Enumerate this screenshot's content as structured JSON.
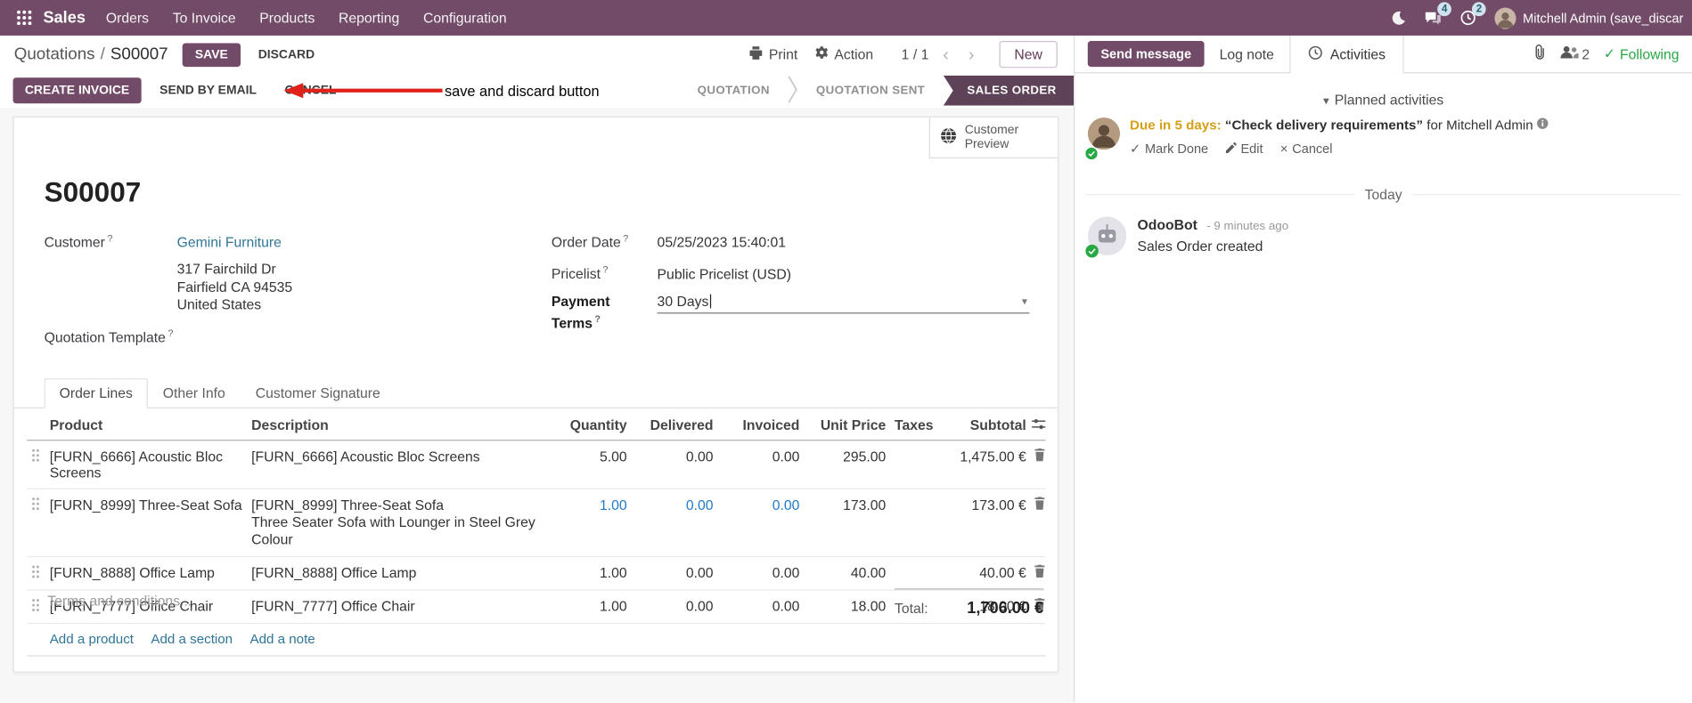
{
  "icons": {
    "prev": "‹",
    "next": "›",
    "caret_down": "▾",
    "check": "✓",
    "close": "×",
    "help": "?"
  },
  "colors": {
    "primary": "#714B67",
    "stage_active": "#5E4257",
    "link": "#2F7599",
    "edited_cell": "#2079C9",
    "warning": "#D4A017",
    "success": "#28A745",
    "annotation_red": "#E0211A"
  },
  "navbar": {
    "app_name": "Sales",
    "menus": [
      "Orders",
      "To Invoice",
      "Products",
      "Reporting",
      "Configuration"
    ],
    "messages_badge": "4",
    "activities_badge": "2",
    "user_name": "Mitchell Admin (save_discar"
  },
  "breadcrumb": {
    "parent": "Quotations",
    "separator": "/",
    "current": "S00007"
  },
  "header_actions": {
    "save": "SAVE",
    "discard": "DISCARD",
    "print": "Print",
    "action": "Action",
    "pager": "1 / 1",
    "new": "New"
  },
  "annotation": {
    "label": "save and discard button"
  },
  "action_buttons": {
    "create_invoice": "CREATE INVOICE",
    "send_by_email": "SEND BY EMAIL",
    "cancel": "CANCEL"
  },
  "statusbar": {
    "stages": [
      {
        "label": "QUOTATION",
        "active": false
      },
      {
        "label": "QUOTATION SENT",
        "active": false
      },
      {
        "label": "SALES ORDER",
        "active": true
      }
    ]
  },
  "sheet": {
    "preview_button": "Customer Preview",
    "title": "S00007",
    "fields": {
      "customer": {
        "label": "Customer",
        "value": "Gemini Furniture"
      },
      "address": [
        "317 Fairchild Dr",
        "Fairfield CA 94535",
        "United States"
      ],
      "quotation_template": {
        "label": "Quotation Template",
        "value": ""
      },
      "order_date": {
        "label": "Order Date",
        "value": "05/25/2023 15:40:01"
      },
      "pricelist": {
        "label": "Pricelist",
        "value": "Public Pricelist (USD)"
      },
      "payment_terms": {
        "label": "Payment Terms",
        "value": "30 Days"
      }
    },
    "tabs": [
      {
        "label": "Order Lines"
      },
      {
        "label": "Other Info"
      },
      {
        "label": "Customer Signature"
      }
    ],
    "order_lines": {
      "columns": [
        "Product",
        "Description",
        "Quantity",
        "Delivered",
        "Invoiced",
        "Unit Price",
        "Taxes",
        "Subtotal"
      ],
      "rows": [
        {
          "product": "[FURN_6666] Acoustic Bloc Screens",
          "description": "[FURN_6666] Acoustic Bloc Screens",
          "description2": "",
          "quantity": "5.00",
          "delivered": "0.00",
          "invoiced": "0.00",
          "unit_price": "295.00",
          "taxes": "",
          "subtotal": "1,475.00 €"
        },
        {
          "product": "[FURN_8999] Three-Seat Sofa",
          "description": "[FURN_8999] Three-Seat Sofa",
          "description2": "Three Seater Sofa with Lounger in Steel Grey Colour",
          "quantity": "1.00",
          "delivered": "0.00",
          "invoiced": "0.00",
          "unit_price": "173.00",
          "taxes": "",
          "subtotal": "173.00 €"
        },
        {
          "product": "[FURN_8888] Office Lamp",
          "description": "[FURN_8888] Office Lamp",
          "description2": "",
          "quantity": "1.00",
          "delivered": "0.00",
          "invoiced": "0.00",
          "unit_price": "40.00",
          "taxes": "",
          "subtotal": "40.00 €"
        },
        {
          "product": "[FURN_7777] Office Chair",
          "description": "[FURN_7777] Office Chair",
          "description2": "",
          "quantity": "1.00",
          "delivered": "0.00",
          "invoiced": "0.00",
          "unit_price": "18.00",
          "taxes": "",
          "subtotal": "18.00 €"
        }
      ],
      "links": [
        "Add a product",
        "Add a section",
        "Add a note"
      ],
      "terms_placeholder": "Terms and conditions...",
      "total_label": "Total:",
      "total_value": "1,706.00 €"
    }
  },
  "chatter": {
    "send_message": "Send message",
    "log_note": "Log note",
    "activities_tab": "Activities",
    "followers_count": "2",
    "following": "Following",
    "planned_header": "Planned activities",
    "activity": {
      "due": "Due in 5 days:",
      "summary": "“Check delivery requirements”",
      "assignee": "for Mitchell Admin",
      "mark_done": "Mark Done",
      "edit": "Edit",
      "cancel": "Cancel"
    },
    "date_separator": "Today",
    "message": {
      "author": "OdooBot",
      "time": "- 9 minutes ago",
      "body": "Sales Order created"
    }
  }
}
